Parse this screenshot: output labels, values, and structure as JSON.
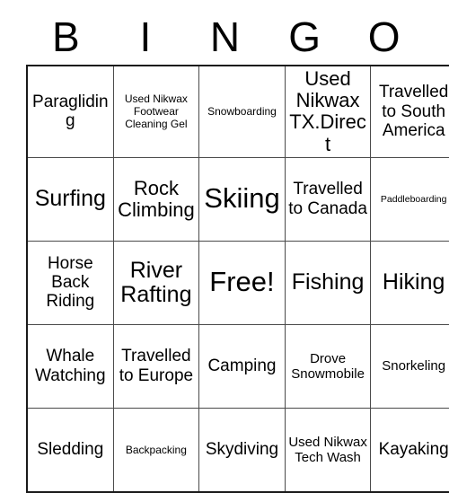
{
  "card": {
    "title": "BINGO",
    "header_letters": [
      "B",
      "I",
      "N",
      "G",
      "O"
    ],
    "free_space_label": "Free!",
    "colors": {
      "text": "#000000",
      "background": "#ffffff",
      "outer_border": "#1a1a1a",
      "cell_border": "#4a4a4a"
    },
    "rows": [
      [
        {
          "label": "Paragliding",
          "size": "md",
          "free": false
        },
        {
          "label": "Used Nikwax Footwear Cleaning Gel",
          "size": "xs",
          "free": false
        },
        {
          "label": "Snowboarding",
          "size": "xs",
          "free": false
        },
        {
          "label": "Used Nikwax TX.Direct",
          "size": "lg",
          "free": false
        },
        {
          "label": "Travelled to South America",
          "size": "md",
          "free": false
        }
      ],
      [
        {
          "label": "Surfing",
          "size": "xl",
          "free": false
        },
        {
          "label": "Rock Climbing",
          "size": "lg",
          "free": false
        },
        {
          "label": "Skiing",
          "size": "xxl",
          "free": false
        },
        {
          "label": "Travelled to Canada",
          "size": "md",
          "free": false
        },
        {
          "label": "Paddleboarding",
          "size": "xxs",
          "free": false
        }
      ],
      [
        {
          "label": "Horse Back Riding",
          "size": "md",
          "free": false
        },
        {
          "label": "River Rafting",
          "size": "xl",
          "free": false
        },
        {
          "label": "Free!",
          "size": "xxl",
          "free": true
        },
        {
          "label": "Fishing",
          "size": "xl",
          "free": false
        },
        {
          "label": "Hiking",
          "size": "xl",
          "free": false
        }
      ],
      [
        {
          "label": "Whale Watching",
          "size": "md",
          "free": false
        },
        {
          "label": "Travelled to Europe",
          "size": "md",
          "free": false
        },
        {
          "label": "Camping",
          "size": "md",
          "free": false
        },
        {
          "label": "Drove Snowmobile",
          "size": "sm",
          "free": false
        },
        {
          "label": "Snorkeling",
          "size": "sm",
          "free": false
        }
      ],
      [
        {
          "label": "Sledding",
          "size": "md",
          "free": false
        },
        {
          "label": "Backpacking",
          "size": "xs",
          "free": false
        },
        {
          "label": "Skydiving",
          "size": "md",
          "free": false
        },
        {
          "label": "Used Nikwax Tech Wash",
          "size": "sm",
          "free": false
        },
        {
          "label": "Kayaking",
          "size": "md",
          "free": false
        }
      ]
    ]
  }
}
